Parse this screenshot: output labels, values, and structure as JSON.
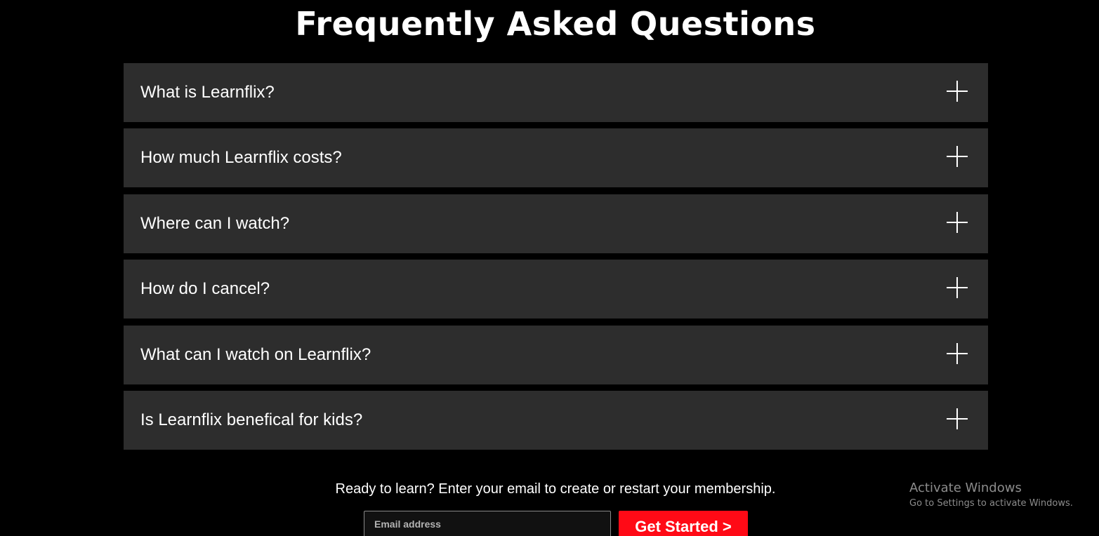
{
  "faq": {
    "title": "Frequently Asked Questions",
    "items": [
      {
        "question": "What is Learnflix?"
      },
      {
        "question": "How much Learnflix costs?"
      },
      {
        "question": "Where can I watch?"
      },
      {
        "question": "How do I cancel?"
      },
      {
        "question": "What can I watch on Learnflix?"
      },
      {
        "question": "Is Learnflix benefical for kids?"
      }
    ],
    "expand_icon": "plus-icon"
  },
  "cta": {
    "text": "Ready to learn? Enter your email to create or restart your membership.",
    "email_placeholder": "Email address",
    "email_value": "",
    "button_label": "Get Started >"
  },
  "watermark": {
    "title": "Activate Windows",
    "subtitle": "Go to Settings to activate Windows."
  },
  "colors": {
    "background": "#000000",
    "item_background": "#2d2d2d",
    "accent": "#ff0a16",
    "text": "#ffffff"
  }
}
